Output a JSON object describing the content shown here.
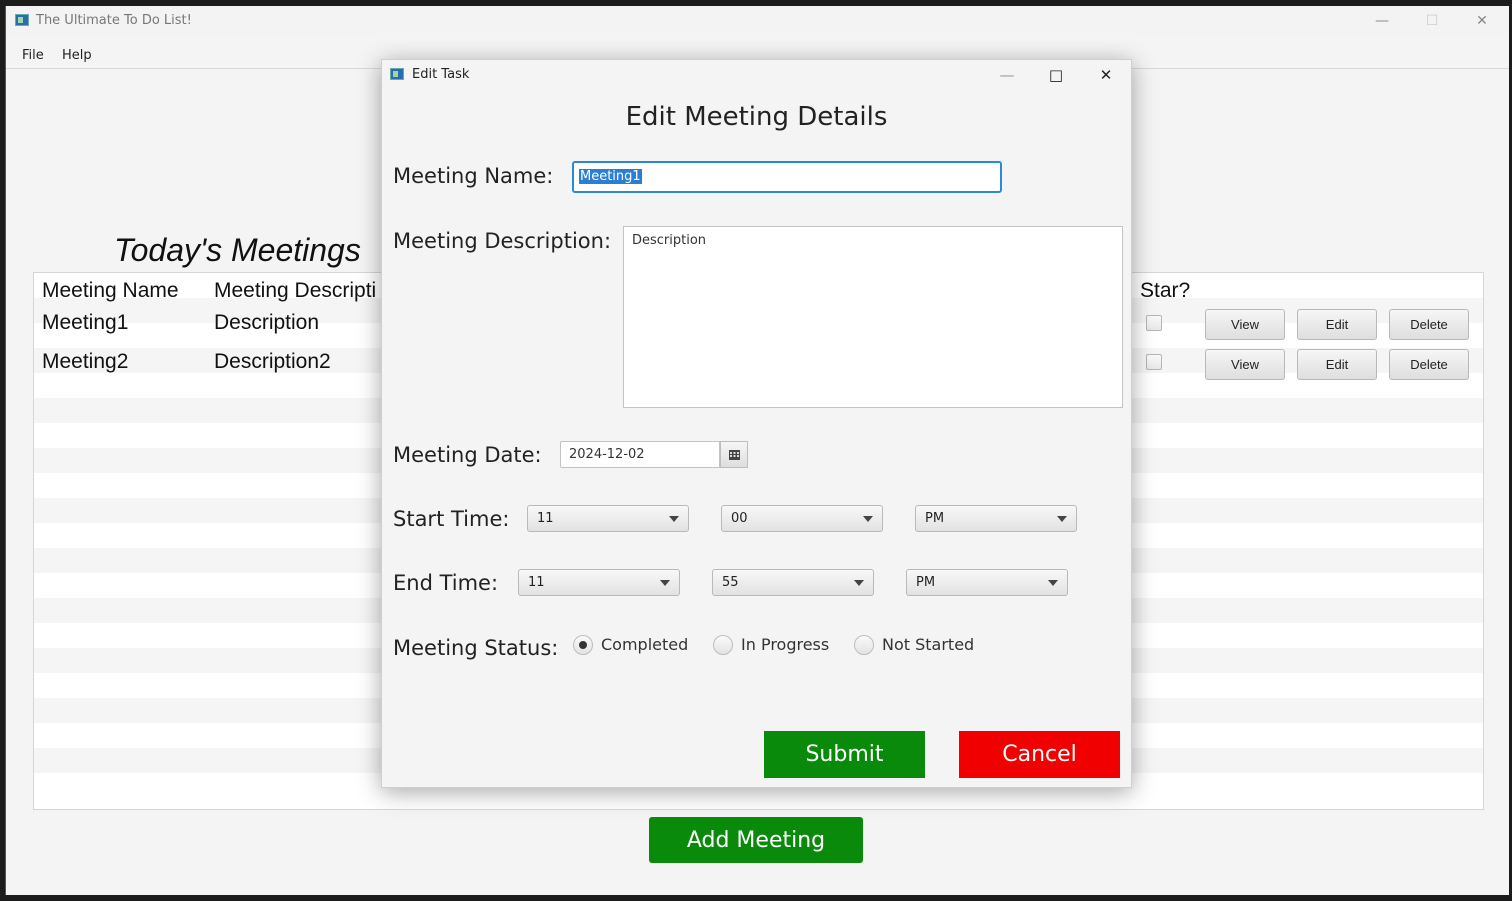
{
  "main_window": {
    "title": "The Ultimate To Do List!",
    "controls": {
      "minimize": "—",
      "maximize": "☐",
      "close": "✕"
    },
    "menu": [
      "File",
      "Help"
    ]
  },
  "page": {
    "heading": "Today's Meetings",
    "table": {
      "headers": [
        "Meeting Name",
        "Meeting Descripti",
        "Star?"
      ],
      "rows": [
        {
          "name": "Meeting1",
          "description": "Description",
          "star": false,
          "view": "View",
          "edit": "Edit",
          "delete": "Delete"
        },
        {
          "name": "Meeting2",
          "description": "Description2",
          "star": false,
          "view": "View",
          "edit": "Edit",
          "delete": "Delete"
        }
      ]
    },
    "add_button": "Add Meeting"
  },
  "dialog": {
    "title": "Edit Task",
    "controls": {
      "minimize": "—",
      "maximize": "□",
      "close": "✕"
    },
    "heading": "Edit Meeting Details",
    "name_label": "Meeting Name:",
    "name_value": "Meeting1",
    "description_label": "Meeting Description:",
    "description_value": "Description",
    "date_label": "Meeting Date:",
    "date_value": "2024-12-02",
    "date_icon": "calendar-icon",
    "start_label": "Start Time:",
    "start": {
      "hour": "11",
      "minute": "00",
      "ampm": "PM"
    },
    "end_label": "End Time:",
    "end": {
      "hour": "11",
      "minute": "55",
      "ampm": "PM"
    },
    "status_label": "Meeting Status:",
    "status_options": [
      "Completed",
      "In Progress",
      "Not Started"
    ],
    "status_selected": "Completed",
    "submit": "Submit",
    "cancel": "Cancel"
  },
  "colors": {
    "submit": "#0a8a0a",
    "cancel": "#f00000",
    "add": "#0a8a0a",
    "focus": "#2a8ad6"
  }
}
